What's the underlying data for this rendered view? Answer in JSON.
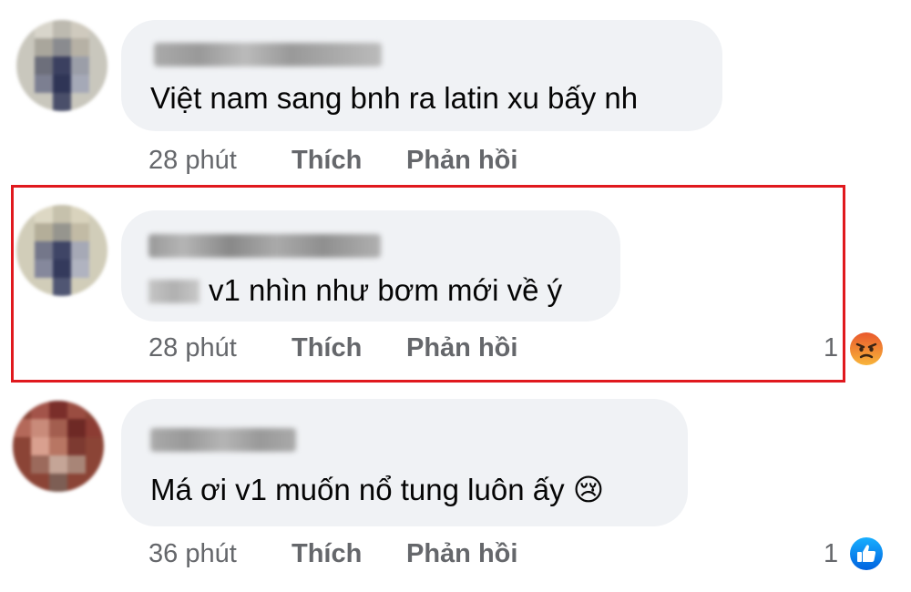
{
  "comments": [
    {
      "text": "Việt nam sang bnh ra latin xu bấy nh",
      "time": "28 phút",
      "like_label": "Thích",
      "reply_label": "Phản hồi"
    },
    {
      "text": "v1 nhìn như bơm mới về ý",
      "time": "28 phút",
      "like_label": "Thích",
      "reply_label": "Phản hồi",
      "reaction_count": "1",
      "reaction_icon": "angry-reaction-icon"
    },
    {
      "text": "Má ơi v1 muốn nổ tung luôn ấy 😢",
      "time": "36 phút",
      "like_label": "Thích",
      "reply_label": "Phản hồi",
      "reaction_count": "1",
      "reaction_icon": "like-reaction-icon"
    }
  ],
  "colors": {
    "bubble": "#f0f2f5",
    "meta_text": "#65676b",
    "highlight_border": "#e0191e",
    "like_blue": "#1877f2",
    "angry_orange": "#f26b22"
  }
}
